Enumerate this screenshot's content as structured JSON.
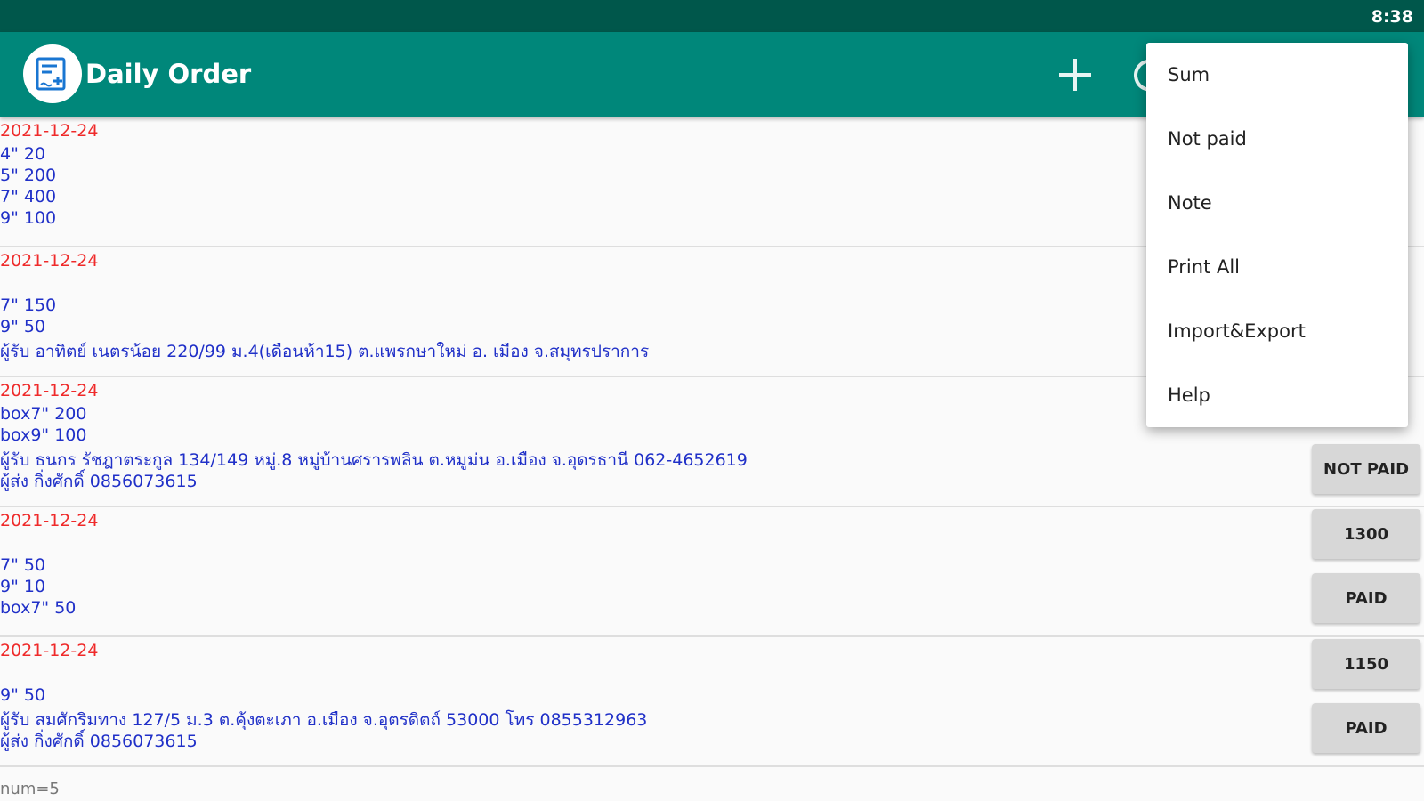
{
  "status_bar": {
    "time": "8:38"
  },
  "app_bar": {
    "title": "Daily Order",
    "add_icon": "plus-icon",
    "refresh_icon": "refresh-icon"
  },
  "orders": [
    {
      "date": "2021-12-24",
      "lines": [
        "4\" 20",
        "5\" 200",
        "7\" 400",
        "9\" 100"
      ]
    },
    {
      "date": "2021-12-24",
      "lines": [
        "7\" 150",
        "9\" 50",
        "ผู้รับ อาทิตย์ เนตรน้อย 220/99 ม.4(เดือนห้า15) ต.แพรกษาใหม่ อ. เมือง จ.สมุทรปราการ"
      ]
    },
    {
      "date": "2021-12-24",
      "lines": [
        "box7\" 200",
        "box9\" 100",
        "ผู้รับ ธนกร  รัชฎาตระกูล 134/149  หมู่.8 หมู่บ้านศรารพลิน ต.หมูม่น  อ.เมือง  จ.อุดรธานี  062-4652619",
        "ผู้ส่ง กิ่งศักดิ์ 0856073615"
      ],
      "button": "NOT PAID"
    },
    {
      "date": "2021-12-24",
      "lines": [
        "7\" 50",
        "9\" 10",
        "box7\" 50"
      ],
      "amount": "1300",
      "button": "PAID"
    },
    {
      "date": "2021-12-24",
      "lines": [
        "9\" 50",
        "ผู้รับ สมศักริมทาง 127/5 ม.3 ต.คุ้งตะเภา อ.เมือง จ.อุตรดิตถ์ 53000 โทร 0855312963",
        "ผู้ส่ง กิ่งศักดิ์ 0856073615"
      ],
      "amount": "1150",
      "button": "PAID"
    }
  ],
  "count_label": "num=5",
  "menu": {
    "items": [
      "Sum",
      "Not paid",
      "Note",
      "Print All",
      "Import&Export",
      "Help"
    ]
  }
}
